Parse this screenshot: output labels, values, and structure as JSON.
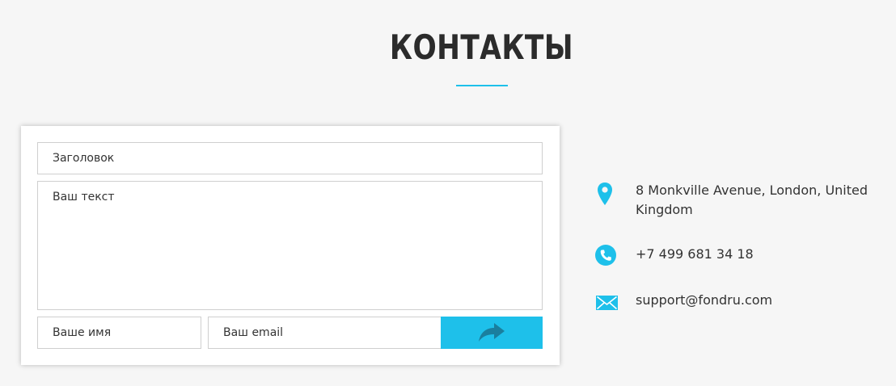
{
  "section": {
    "title": "КОНТАКТЫ"
  },
  "form": {
    "title_placeholder": "Заголовок",
    "text_placeholder": "Ваш текст",
    "name_placeholder": "Ваше имя",
    "email_placeholder": "Ваш email",
    "send_icon": "share-arrow-icon"
  },
  "contacts": {
    "address": "8 Monkville Avenue, London, United Kingdom",
    "address_icon": "map-pin-icon",
    "phone": "+7 499 681 34 18",
    "phone_icon": "phone-icon",
    "email": "support@fondru.com",
    "email_icon": "envelope-icon"
  },
  "colors": {
    "accent": "#1ec0ea",
    "background": "#f6f6f6",
    "text": "#333333"
  }
}
